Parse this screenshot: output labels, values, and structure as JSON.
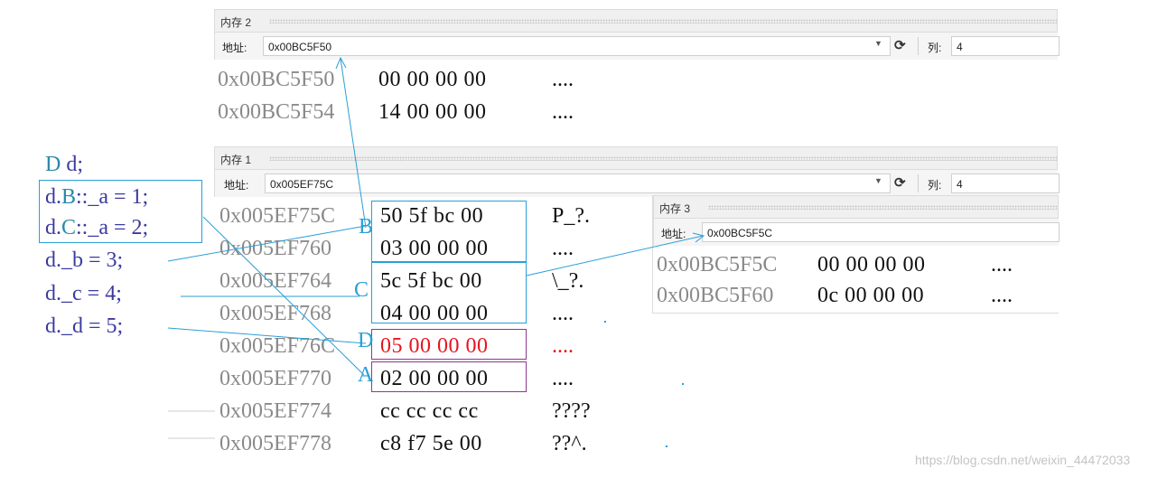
{
  "memory2": {
    "title": "内存 2",
    "addr_label": "地址:",
    "address": "0x00BC5F50",
    "col_label": "列:",
    "col_value": "4",
    "rows": [
      {
        "addr": "0x00BC5F50",
        "bytes": "00 00 00 00",
        "ascii": "...."
      },
      {
        "addr": "0x00BC5F54",
        "bytes": "14 00 00 00",
        "ascii": "...."
      }
    ]
  },
  "memory1": {
    "title": "内存 1",
    "addr_label": "地址:",
    "address": "0x005EF75C",
    "col_label": "列:",
    "col_value": "4",
    "rows": [
      {
        "addr": "0x005EF75C",
        "bytes": "50 5f bc 00",
        "ascii": "P_?."
      },
      {
        "addr": "0x005EF760",
        "bytes": "03 00 00 00",
        "ascii": "...."
      },
      {
        "addr": "0x005EF764",
        "bytes": "5c 5f bc 00",
        "ascii": "\\_?."
      },
      {
        "addr": "0x005EF768",
        "bytes": "04 00 00 00",
        "ascii": "...."
      },
      {
        "addr": "0x005EF76C",
        "bytes": "05 00 00 00",
        "ascii": "...."
      },
      {
        "addr": "0x005EF770",
        "bytes": "02 00 00 00",
        "ascii": "...."
      },
      {
        "addr": "0x005EF774",
        "bytes": "cc cc cc cc",
        "ascii": "????"
      },
      {
        "addr": "0x005EF778",
        "bytes": "c8 f7 5e 00",
        "ascii": "??^."
      }
    ]
  },
  "memory3": {
    "title": "内存 3",
    "addr_label": "地址:",
    "address": "0x00BC5F5C",
    "rows": [
      {
        "addr": "0x00BC5F5C",
        "bytes": "00 00 00 00",
        "ascii": "...."
      },
      {
        "addr": "0x00BC5F60",
        "bytes": "0c 00 00 00",
        "ascii": "...."
      }
    ]
  },
  "code": {
    "lines": [
      {
        "obj": "D",
        "rest": " d;"
      },
      {
        "obj": "d.",
        "member": "B",
        "rest": "::_a = 1;"
      },
      {
        "obj": "d.",
        "member": "C",
        "rest": "::_a = 2;"
      },
      {
        "obj": "d.",
        "rest": "_b = 3;"
      },
      {
        "obj": "d.",
        "rest": "_c = 4;"
      },
      {
        "obj": "d.",
        "rest": "_d = 5;"
      }
    ]
  },
  "annotations": {
    "B": "B",
    "C": "C",
    "D": "D",
    "A": "A"
  },
  "watermark": "https://blog.csdn.net/weixin_44472033",
  "colors": {
    "accent": "#2a9fd6",
    "highlight_red": "#e8141e",
    "box_purple": "#8a3a8a",
    "box_cyan": "#2a9fd6"
  }
}
